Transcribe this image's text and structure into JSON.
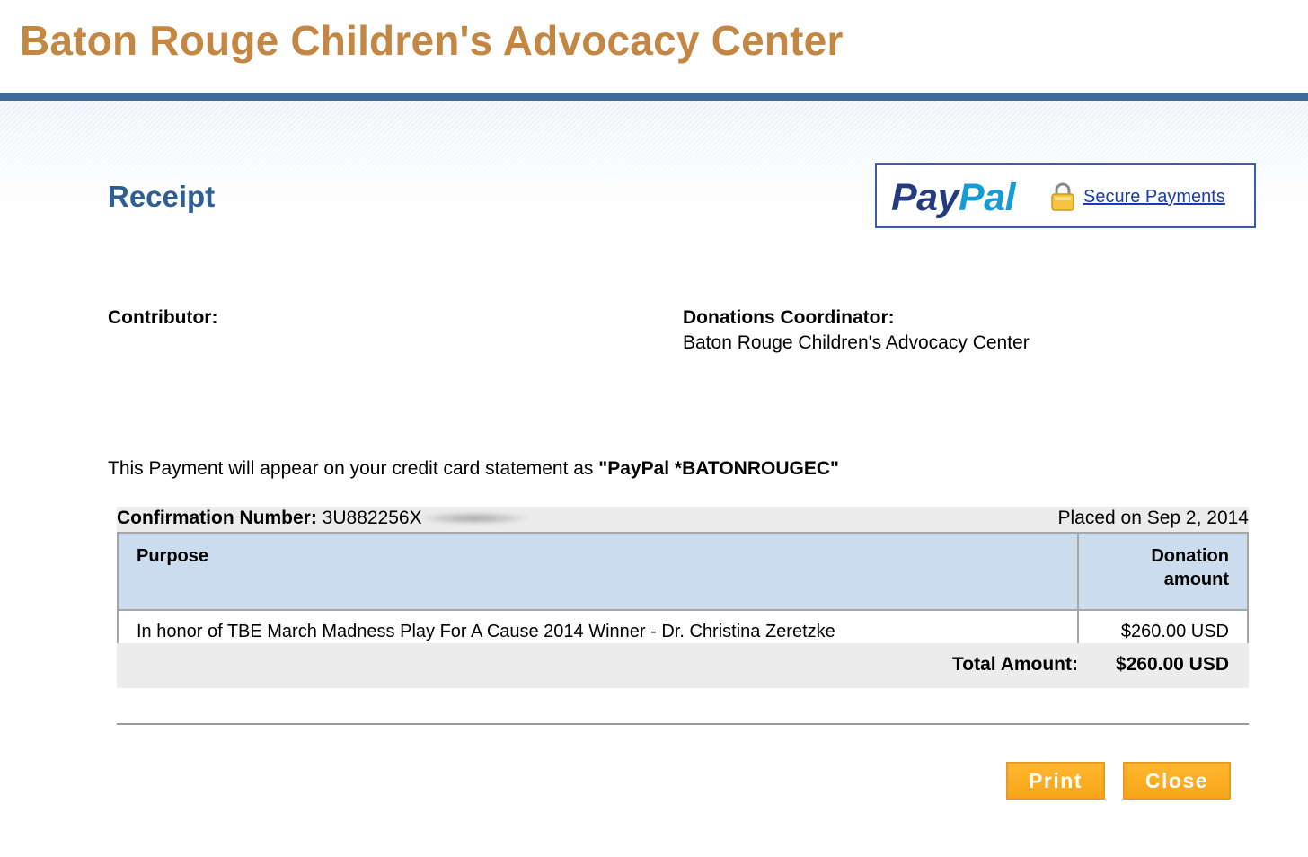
{
  "header": {
    "org_title": "Baton Rouge Children's Advocacy Center"
  },
  "receipt": {
    "title": "Receipt"
  },
  "paypal": {
    "logo_pay": "Pay",
    "logo_pal": "Pal",
    "secure_link": "Secure Payments"
  },
  "parties": {
    "contributor_label": "Contributor:",
    "coordinator_label": "Donations Coordinator:",
    "coordinator_name": "Baton Rouge Children's Advocacy Center"
  },
  "statement": {
    "prefix": "This Payment will appear on your credit card statement as ",
    "descriptor": "\"PayPal *BATONROUGEC\""
  },
  "confirmation": {
    "label": "Confirmation Number:",
    "number_visible": "3U882256X",
    "placed_on": "Placed on Sep 2, 2014"
  },
  "table": {
    "headers": {
      "purpose": "Purpose",
      "amount_line1": "Donation",
      "amount_line2": "amount"
    },
    "rows": [
      {
        "purpose": "In honor of TBE March Madness Play For A Cause 2014 Winner - Dr. Christina Zeretzke",
        "amount": "$260.00 USD"
      }
    ],
    "total_label": "Total Amount:",
    "total_value": "$260.00 USD"
  },
  "actions": {
    "print_label": "Print",
    "close_label": "Close"
  },
  "colors": {
    "org_title": "#c48743",
    "top_bar": "#3e6a98",
    "receipt_title": "#2d5f93",
    "table_header_bg": "#cbdcee",
    "button_bg": "#f7a61a"
  },
  "icons": {
    "lock": "lock-icon"
  }
}
